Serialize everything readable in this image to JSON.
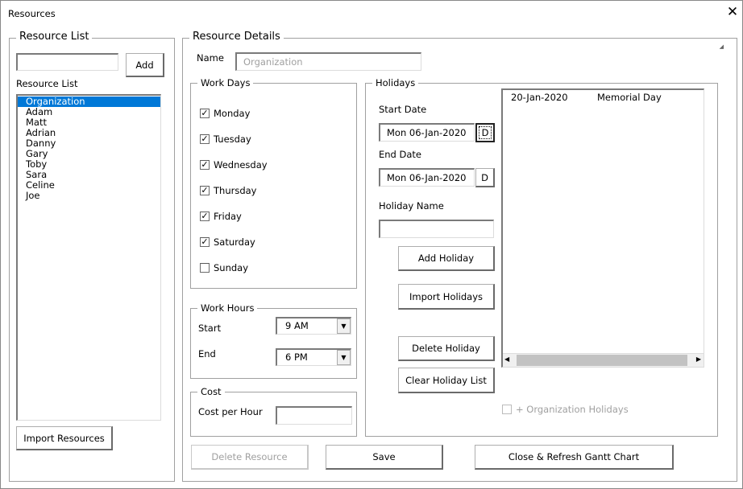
{
  "window": {
    "title": "Resources",
    "close_icon": "close-icon"
  },
  "resource_list": {
    "frame_title": "Resource List",
    "new_input_value": "",
    "add_label": "Add",
    "list_label": "Resource List",
    "items": [
      "Organization",
      "Adam",
      "Matt",
      "Adrian",
      "Danny",
      "Gary",
      "Toby",
      "Sara",
      "Celine",
      "Joe"
    ],
    "selected": "Organization",
    "import_label": "Import Resources"
  },
  "details": {
    "frame_title": "Resource Details",
    "name_label": "Name",
    "name_value": "Organization",
    "work_days": {
      "title": "Work Days",
      "days": [
        {
          "label": "Monday",
          "checked": true
        },
        {
          "label": "Tuesday",
          "checked": true
        },
        {
          "label": "Wednesday",
          "checked": true
        },
        {
          "label": "Thursday",
          "checked": true
        },
        {
          "label": "Friday",
          "checked": true
        },
        {
          "label": "Saturday",
          "checked": true
        },
        {
          "label": "Sunday",
          "checked": false
        }
      ]
    },
    "work_hours": {
      "title": "Work Hours",
      "start_label": "Start",
      "start_value": "9 AM",
      "end_label": "End",
      "end_value": "6 PM"
    },
    "cost": {
      "title": "Cost",
      "label": "Cost per Hour",
      "value": ""
    },
    "holidays": {
      "title": "Holidays",
      "start_label": "Start Date",
      "start_value": "Mon 06-Jan-2020",
      "date_button": "D",
      "end_label": "End Date",
      "end_value": "Mon 06-Jan-2020",
      "name_label": "Holiday Name",
      "name_value": "",
      "add_label": "Add Holiday",
      "import_label": "Import Holidays",
      "delete_label": "Delete Holiday",
      "clear_label": "Clear Holiday List",
      "list": [
        {
          "date": "20-Jan-2020",
          "name": "Memorial Day"
        }
      ],
      "org_holidays_label": "+ Organization Holidays",
      "org_holidays_checked": false
    },
    "delete_label": "Delete Resource",
    "save_label": "Save",
    "close_label": "Close & Refresh Gantt Chart"
  }
}
